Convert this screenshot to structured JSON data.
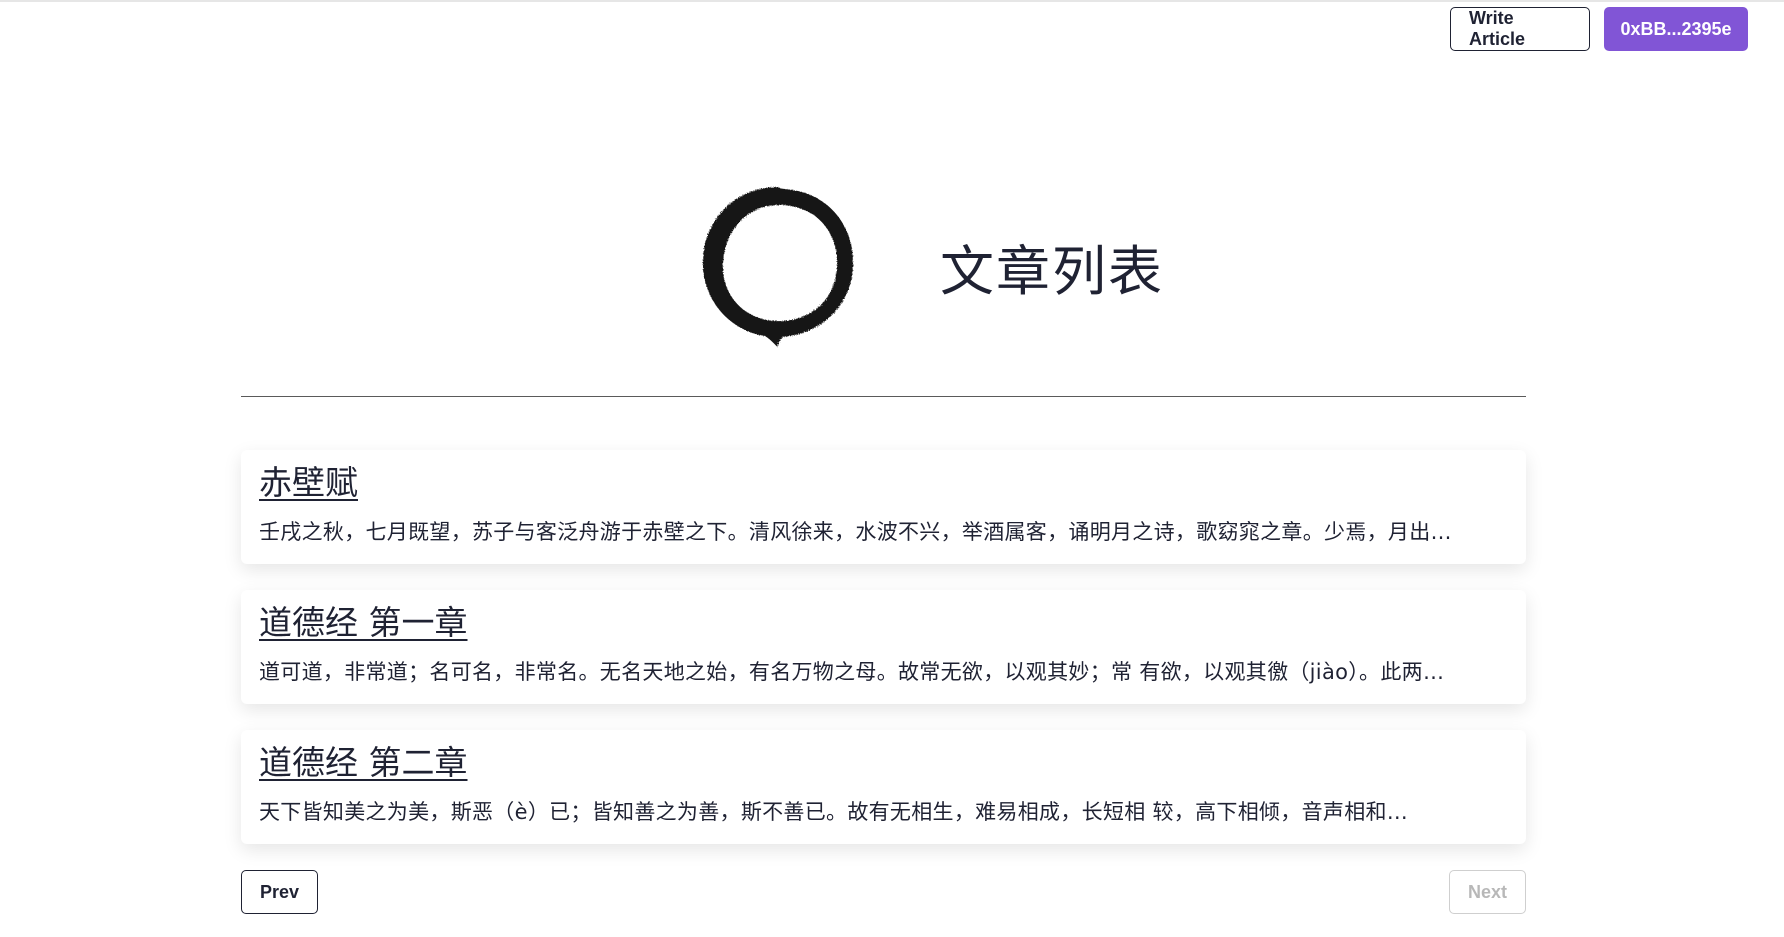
{
  "header": {
    "write_label": "Write Article",
    "wallet_label": "0xBB...2395e"
  },
  "hero": {
    "logo_icon": "enso-circle-icon",
    "title": "文章列表"
  },
  "articles": [
    {
      "title": "赤壁赋",
      "excerpt": "壬戌之秋，七月既望，苏子与客泛舟游于赤壁之下。清风徐来，水波不兴，举酒属客，诵明月之诗，歌窈窕之章。少焉，月出…"
    },
    {
      "title": "道德经 第一章",
      "excerpt": "道可道，非常道；名可名，非常名。无名天地之始，有名万物之母。故常无欲，以观其妙；常 有欲，以观其徼（jiào）。此两…"
    },
    {
      "title": "道德经 第二章",
      "excerpt": "天下皆知美之为美，斯恶（è）已；皆知善之为善，斯不善已。故有无相生，难易相成，长短相 较，高下相倾，音声相和…"
    }
  ],
  "pagination": {
    "prev_label": "Prev",
    "next_label": "Next"
  },
  "colors": {
    "accent": "#8155d6",
    "text": "#1f2233",
    "disabled": "#b8b8b8"
  }
}
